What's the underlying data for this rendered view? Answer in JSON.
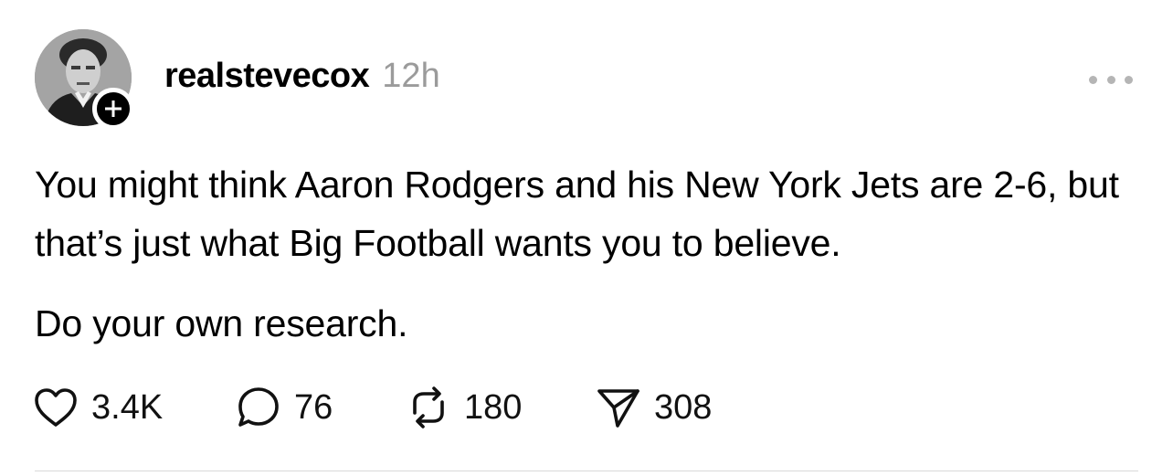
{
  "post": {
    "username": "realstevecox",
    "timestamp": "12h",
    "paragraphs": [
      "You might think Aaron Rodgers and his New York Jets are 2-6, but that’s just what Big Football wants you to believe.",
      "Do your own research."
    ]
  },
  "actions": {
    "likes": "3.4K",
    "replies": "76",
    "reposts": "180",
    "shares": "308"
  },
  "icons": {
    "avatar": "avatar-portrait",
    "follow": "plus-icon",
    "more": "more-dots-icon",
    "like": "heart-icon",
    "reply": "reply-bubble-icon",
    "repost": "repost-icon",
    "share": "send-icon"
  },
  "colors": {
    "text": "#000000",
    "muted": "#9b9b9b",
    "badge": "#000000"
  }
}
